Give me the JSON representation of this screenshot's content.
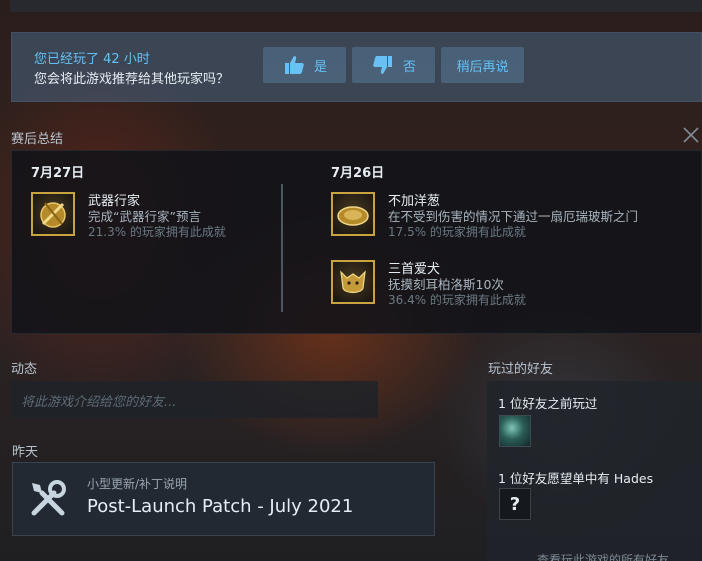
{
  "recommend": {
    "played": "您已经玩了 42 小时",
    "question": "您会将此游戏推荐给其他玩家吗？",
    "yes_label": "是",
    "no_label": "否",
    "later_label": "稍后再说"
  },
  "summary": {
    "title": "赛后总结",
    "columns": [
      {
        "date": "7月27日",
        "achievements": [
          {
            "name": "武器行家",
            "desc": "完成“武器行家”预言",
            "pct": "21.3% 的玩家拥有此成就",
            "icon": "weapon-shield-icon"
          }
        ]
      },
      {
        "date": "7月26日",
        "achievements": [
          {
            "name": "不加洋葱",
            "desc": "在不受到伤害的情况下通过一扇厄瑞玻斯之门",
            "pct": "17.5% 的玩家拥有此成就",
            "icon": "gold-plate-icon"
          },
          {
            "name": "三首爱犬",
            "desc": "抚摸刻耳柏洛斯10次",
            "pct": "36.4% 的玩家拥有此成就",
            "icon": "dog-head-icon"
          }
        ]
      }
    ]
  },
  "activity": {
    "title": "动态",
    "placeholder": "将此游戏介绍给您的好友..."
  },
  "yesterday": {
    "title": "昨天",
    "news_type": "小型更新/补丁说明",
    "news_title": "Post-Launch Patch - July 2021"
  },
  "friends": {
    "title": "玩过的好友",
    "played_before": "1 位好友之前玩过",
    "wishlist": "1 位好友愿望单中有 Hades",
    "unknown_glyph": "?",
    "footer": "查看玩此游戏的所有好友"
  },
  "colors": {
    "accent": "#66c0f4",
    "gold": "#c9a341"
  }
}
